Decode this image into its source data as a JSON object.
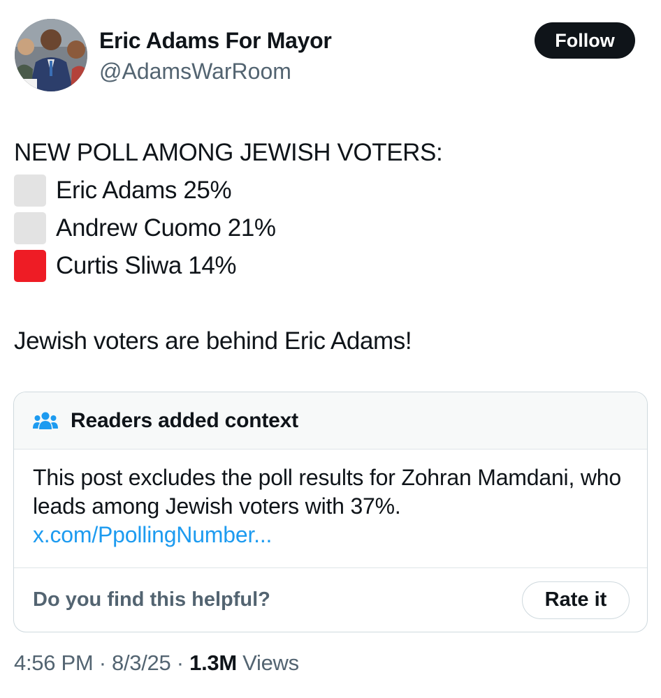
{
  "author": {
    "display_name": "Eric Adams For Mayor",
    "handle": "@AdamsWarRoom",
    "avatar_icon": "profile-photo"
  },
  "follow_label": "Follow",
  "post": {
    "headline": "NEW POLL AMONG JEWISH VOTERS:",
    "poll_lines": [
      {
        "marker": "white-square",
        "marker_color": "#e3e3e3",
        "text": "Eric Adams 25%"
      },
      {
        "marker": "white-square",
        "marker_color": "#e3e3e3",
        "text": "Andrew Cuomo 21%"
      },
      {
        "marker": "red-square",
        "marker_color": "#ee1c25",
        "text": "Curtis Sliwa 14%"
      }
    ],
    "closing": "Jewish voters are behind Eric Adams!"
  },
  "community_note": {
    "icon": "people-icon",
    "title": "Readers added context",
    "body": "This post excludes the poll results for Zohran Mamdani, who leads among Jewish voters with 37%.",
    "link": "x.com/PpollingNumber...",
    "helpful_prompt": "Do you find this helpful?",
    "rate_label": "Rate it"
  },
  "meta": {
    "time": "4:56 PM",
    "date": "8/3/25",
    "views_count": "1.3M",
    "views_label": "Views",
    "separator": "·"
  },
  "colors": {
    "text": "#0f1419",
    "secondary": "#536471",
    "link": "#1d9bf0",
    "note_icon": "#1d9bf0"
  }
}
